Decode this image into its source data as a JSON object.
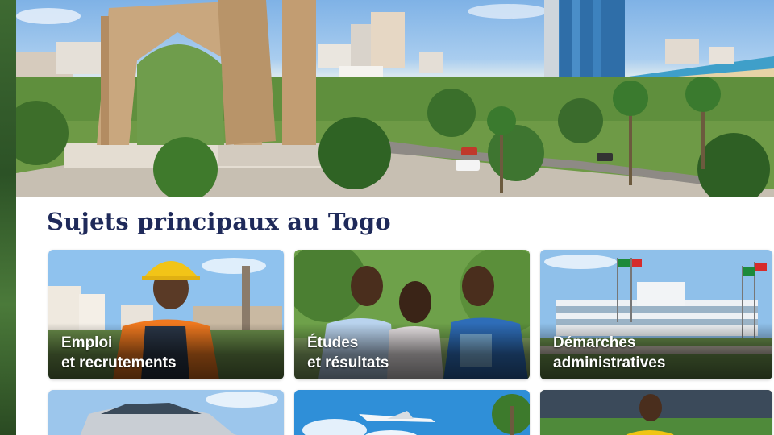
{
  "section": {
    "title": "Sujets principaux au Togo"
  },
  "cards": [
    {
      "line1": "Emploi",
      "line2": "et recrutements"
    },
    {
      "line1": "Études",
      "line2": "et résultats"
    },
    {
      "line1": "Démarches",
      "line2": "administratives"
    },
    {
      "line1": "",
      "line2": ""
    },
    {
      "line1": "",
      "line2": ""
    },
    {
      "line1": "",
      "line2": ""
    }
  ],
  "colors": {
    "title": "#1f2a5a",
    "card_text": "#ffffff"
  }
}
